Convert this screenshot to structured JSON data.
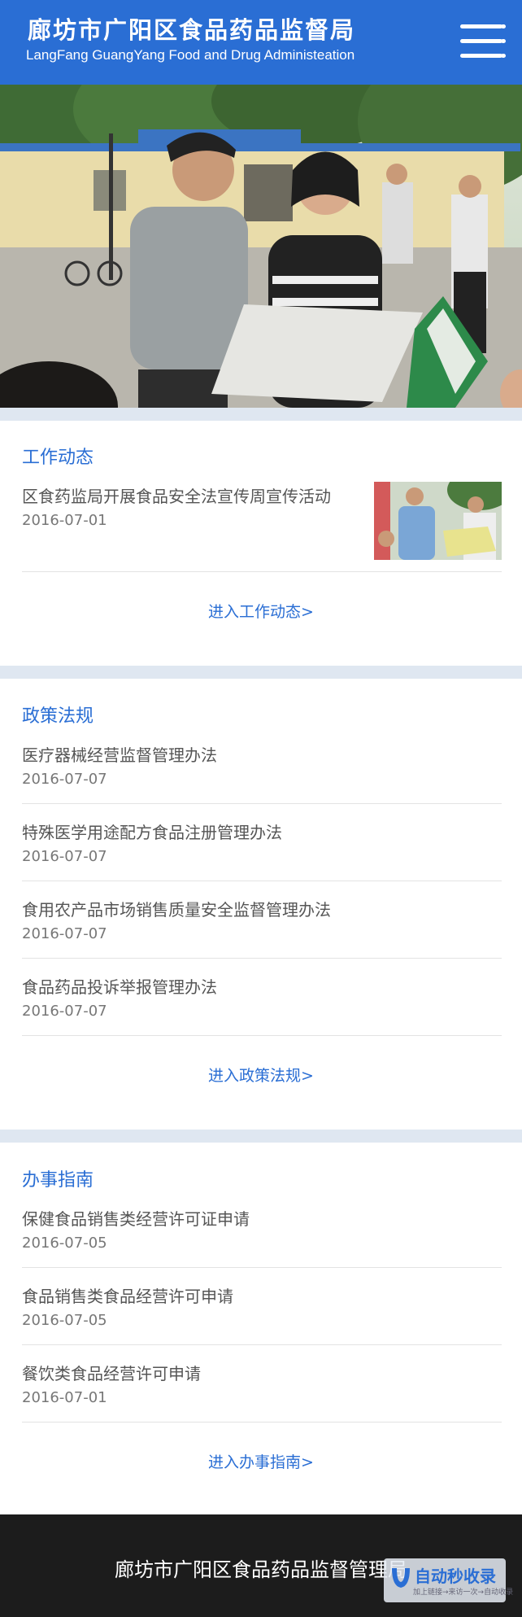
{
  "header": {
    "title": "廊坊市广阳区食品药品监督局",
    "subtitle": "LangFang GuangYang Food and Drug Administeation",
    "menu_icon": "hamburger-menu-icon",
    "bg_color": "#2a6ed4"
  },
  "banner": {
    "image": "photo-officials-reviewing-document-outdoors",
    "slides": 3,
    "active_slide": 2
  },
  "work_news": {
    "title": "工作动态",
    "items": [
      {
        "title": "区食药监局开展食品安全法宣传周宣传活动",
        "date": "2016-07-01",
        "thumbnail": "photo-promotion-event"
      }
    ],
    "more": "进入工作动态>"
  },
  "policy": {
    "title": "政策法规",
    "items": [
      {
        "title": "医疗器械经营监督管理办法",
        "date": "2016-07-07"
      },
      {
        "title": "特殊医学用途配方食品注册管理办法",
        "date": "2016-07-07"
      },
      {
        "title": "食用农产品市场销售质量安全监督管理办法",
        "date": "2016-07-07"
      },
      {
        "title": "食品药品投诉举报管理办法",
        "date": "2016-07-07"
      }
    ],
    "more": "进入政策法规>"
  },
  "guide": {
    "title": "办事指南",
    "items": [
      {
        "title": "保健食品销售类经营许可证申请",
        "date": "2016-07-05"
      },
      {
        "title": "食品销售类食品经营许可申请",
        "date": "2016-07-05"
      },
      {
        "title": "餐饮类食品经营许可申请",
        "date": "2016-07-01"
      }
    ],
    "more": "进入办事指南>"
  },
  "footer": {
    "text": "廊坊市广阳区食品药品监督管理局"
  },
  "watermark": {
    "name": "自动秒收录",
    "tagline": "加上链接→来访一次→自动收录"
  },
  "colors": {
    "accent": "#2a6ed4",
    "section_gap": "#dfe7f1",
    "footer_bg": "#1c1c1c"
  }
}
